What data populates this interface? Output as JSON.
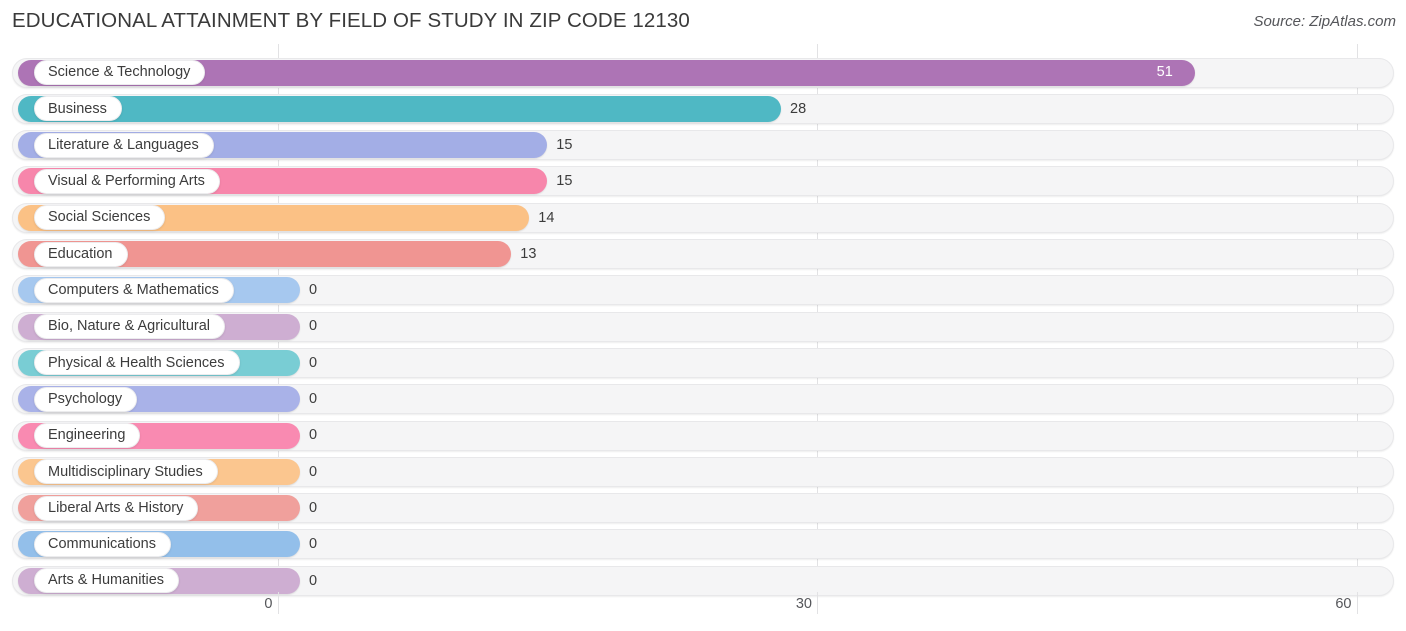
{
  "header": {
    "title": "EDUCATIONAL ATTAINMENT BY FIELD OF STUDY IN ZIP CODE 12130",
    "source": "Source: ZipAtlas.com"
  },
  "chart_data": {
    "type": "bar",
    "orientation": "horizontal",
    "title": "EDUCATIONAL ATTAINMENT BY FIELD OF STUDY IN ZIP CODE 12130",
    "subtitle": "",
    "xlabel": "",
    "ylabel": "",
    "xlim": [
      0,
      60
    ],
    "ylim": null,
    "grid": true,
    "legend": false,
    "xticks": [
      0,
      30,
      60
    ],
    "xtick_labels": [
      "0",
      "30",
      "60"
    ],
    "categories": [
      "Science & Technology",
      "Business",
      "Literature & Languages",
      "Visual & Performing Arts",
      "Social Sciences",
      "Education",
      "Computers & Mathematics",
      "Bio, Nature & Agricultural",
      "Physical & Health Sciences",
      "Psychology",
      "Engineering",
      "Multidisciplinary Studies",
      "Liberal Arts & History",
      "Communications",
      "Arts & Humanities"
    ],
    "values": [
      51,
      28,
      15,
      15,
      14,
      13,
      0,
      0,
      0,
      0,
      0,
      0,
      0,
      0,
      0
    ],
    "value_labels": [
      "51",
      "28",
      "15",
      "15",
      "14",
      "13",
      "0",
      "0",
      "0",
      "0",
      "0",
      "0",
      "0",
      "0",
      "0"
    ],
    "colors": [
      "#ad74b5",
      "#4fb8c4",
      "#a3aee6",
      "#f786ab",
      "#fbc185",
      "#f09592",
      "#a6c8ef",
      "#ceaed2",
      "#79cdd4",
      "#a9b2e8",
      "#f98ab1",
      "#fbc68f",
      "#f0a09c",
      "#93bfea",
      "#ceaed2"
    ]
  },
  "colors": {
    "track": "#f5f5f6",
    "track_border": "#e8e8ea",
    "gridline": "#e2e2e4",
    "pill_bg": "#ffffff",
    "text": "#3c3c3c",
    "axis_text": "#55565a",
    "background": "#ffffff"
  }
}
